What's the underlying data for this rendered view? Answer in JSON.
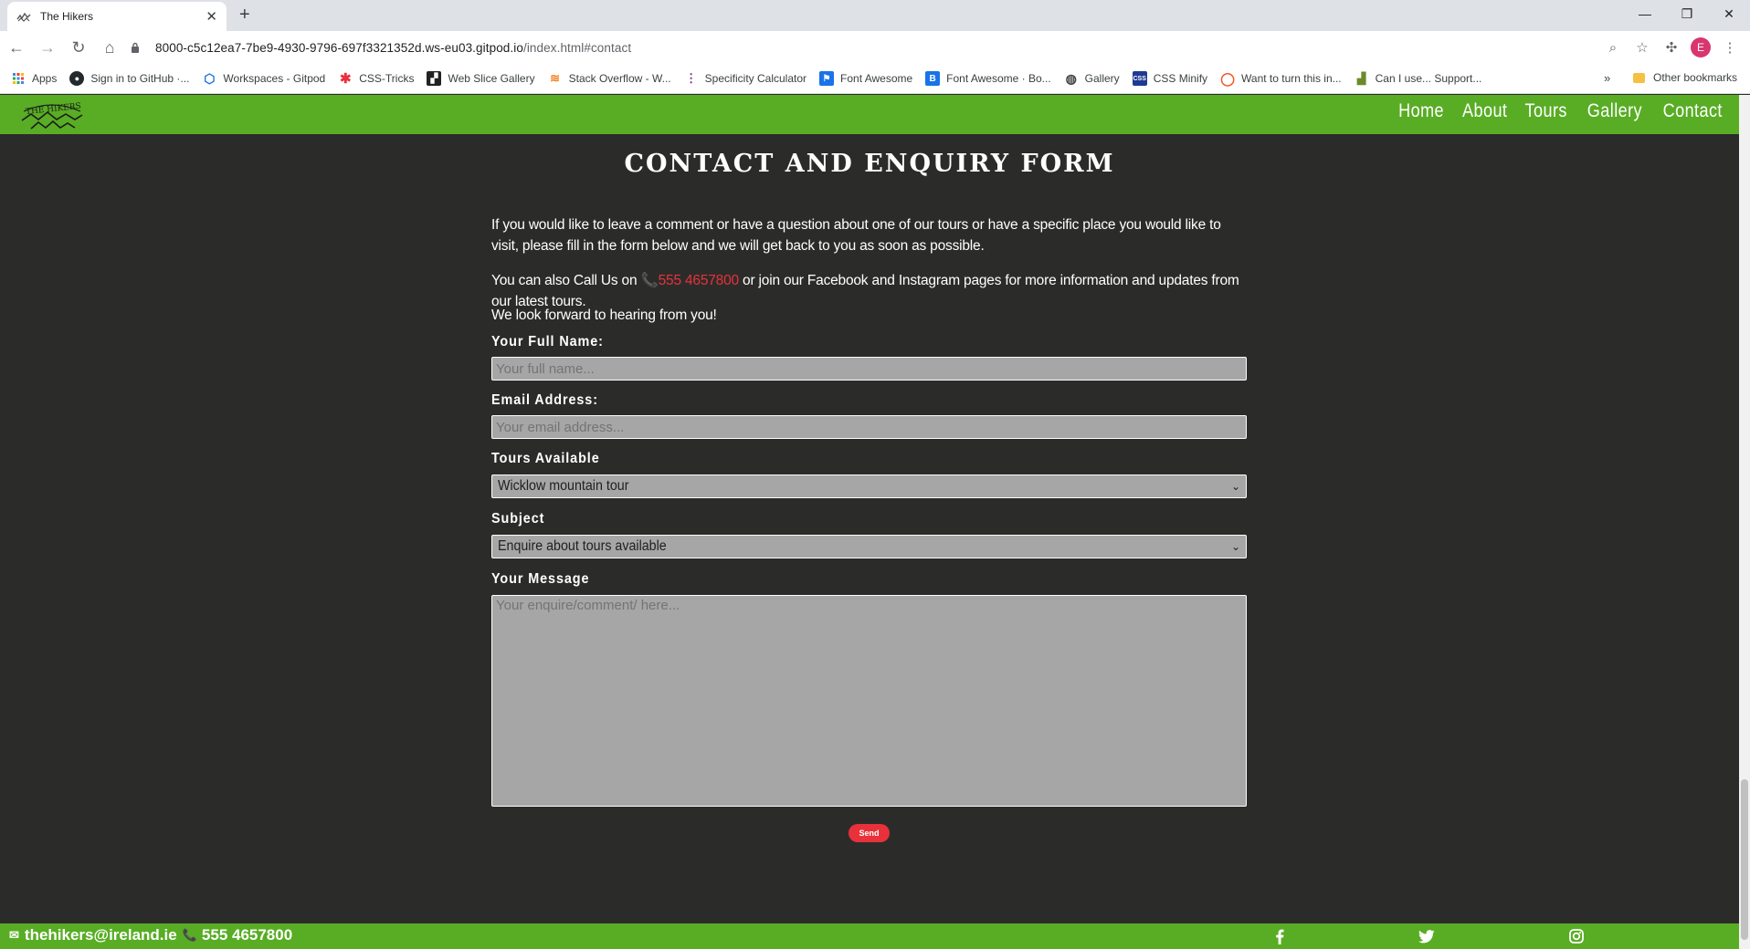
{
  "browser": {
    "tab_title": "The Hikers",
    "url_host": "8000-c5c12ea7-7be9-4930-9796-697f3321352d.ws-eu03.gitpod.io",
    "url_path": "/index.html#contact",
    "profile_initial": "E",
    "bookmarks": [
      {
        "label": "Apps",
        "icon": "apps-grid-icon"
      },
      {
        "label": "Sign in to GitHub ·...",
        "icon": "github-icon"
      },
      {
        "label": "Workspaces - Gitpod",
        "icon": "gitpod-icon"
      },
      {
        "label": "CSS-Tricks",
        "icon": "css-tricks-icon"
      },
      {
        "label": "Web Slice Gallery",
        "icon": "web-slice-icon"
      },
      {
        "label": "Stack Overflow - W...",
        "icon": "stackoverflow-icon"
      },
      {
        "label": "Specificity Calculator",
        "icon": "specificity-icon"
      },
      {
        "label": "Font Awesome",
        "icon": "font-awesome-icon"
      },
      {
        "label": "Font Awesome · Bo...",
        "icon": "bootstrap-icon"
      },
      {
        "label": "Gallery",
        "icon": "globe-icon"
      },
      {
        "label": "CSS Minify",
        "icon": "css-minify-icon"
      },
      {
        "label": "Want to turn this in...",
        "icon": "circle-icon"
      },
      {
        "label": "Can I use... Support...",
        "icon": "caniuse-icon"
      }
    ],
    "more_bookmarks": "»",
    "other_bookmarks": "Other bookmarks"
  },
  "site": {
    "nav": [
      "Home",
      "About",
      "Tours",
      "Gallery",
      "Contact"
    ],
    "title": "CONTACT AND ENQUIRY FORM",
    "intro_1": "If you would like to leave a comment or have a question about one of our tours or have a specific place you would like to visit, please fill in the form below and we will get back to you as soon as possible.",
    "intro_2_before": "You can also Call Us on ",
    "intro_2_phone": "555 4657800",
    "intro_2_after": " or join our Facebook and Instagram pages for more information and updates from our latest tours.",
    "intro_3": "We look forward to hearing from you!",
    "form": {
      "name_label": "Your Full Name:",
      "name_placeholder": "Your full name...",
      "email_label": "Email Address:",
      "email_placeholder": "Your email address...",
      "tours_label": "Tours Available",
      "tours_selected": "Wicklow mountain tour",
      "subject_label": "Subject",
      "subject_selected": "Enquire about tours available",
      "message_label": "Your Message",
      "message_placeholder": "Your enquire/comment/ here...",
      "send_label": "Send"
    },
    "footer": {
      "email": "thehikers@ireland.ie",
      "phone": "555 4657800"
    },
    "colors": {
      "nav_green": "#58ad24",
      "background": "#2b2c2a",
      "accent_red": "#e8313a"
    }
  }
}
